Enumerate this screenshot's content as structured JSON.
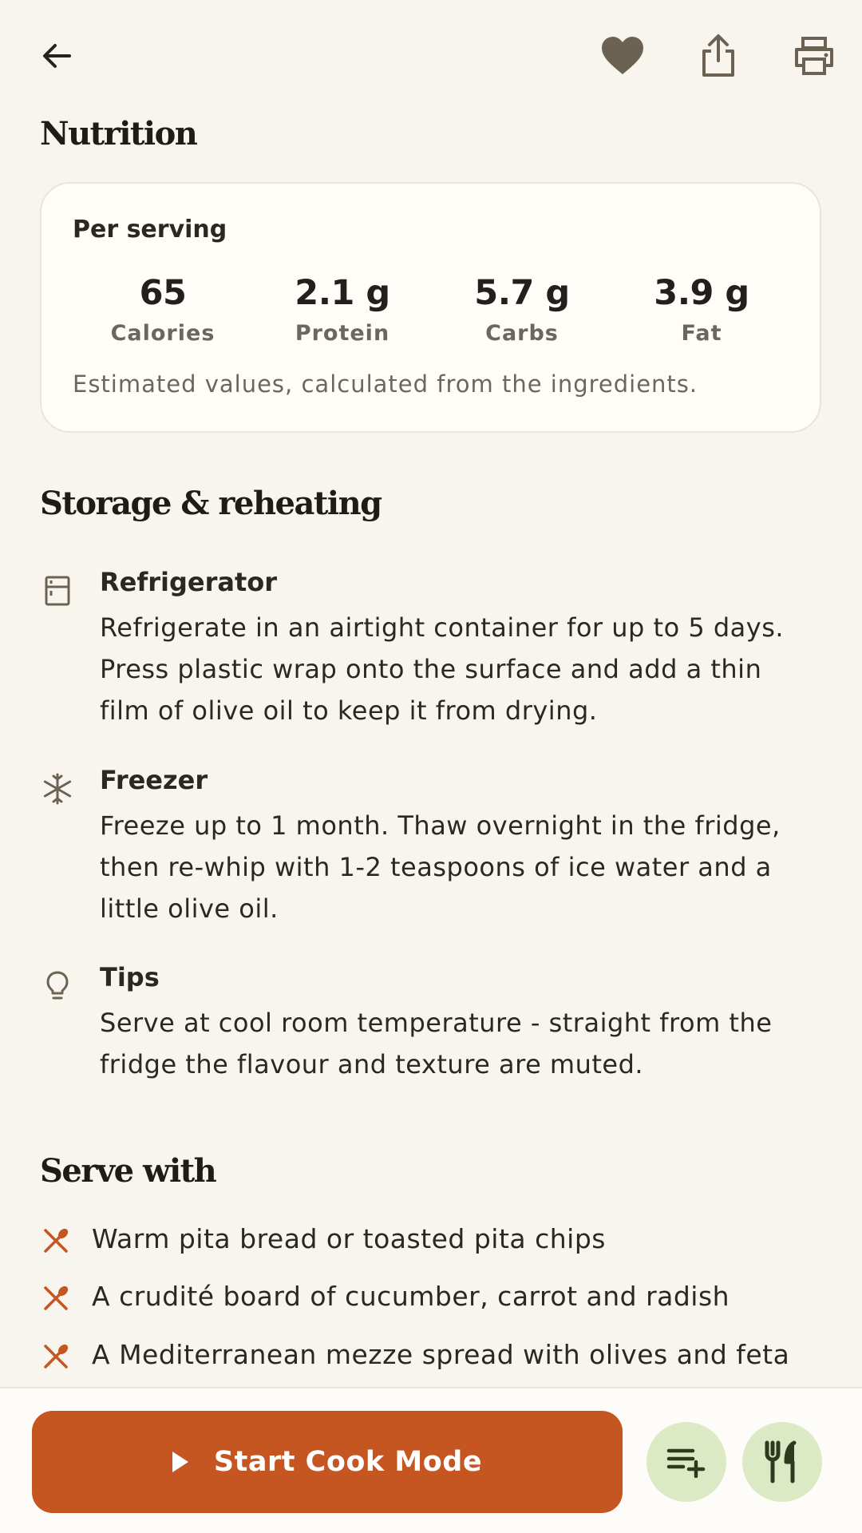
{
  "toolbar": {
    "back_icon": "arrow-left-icon",
    "favorite_icon": "heart-icon",
    "share_icon": "share-icon",
    "print_icon": "printer-icon"
  },
  "nutrition": {
    "title": "Nutrition",
    "per_serving": "Per serving",
    "items": [
      {
        "value": "65",
        "label": "Calories"
      },
      {
        "value": "2.1 g",
        "label": "Protein"
      },
      {
        "value": "5.7 g",
        "label": "Carbs"
      },
      {
        "value": "3.9 g",
        "label": "Fat"
      }
    ],
    "note": "Estimated values, calculated from the ingredients."
  },
  "storage": {
    "title": "Storage & reheating",
    "items": [
      {
        "icon": "refrigerator-icon",
        "title": "Refrigerator",
        "lines": [
          "Refrigerate in an airtight container for up to 5 days.",
          "Press plastic wrap onto the surface and add a thin",
          "film of olive oil to keep it from drying."
        ]
      },
      {
        "icon": "snowflake-icon",
        "title": "Freezer",
        "lines": [
          "Freeze up to 1 month. Thaw overnight in the fridge,",
          "then re-whip with 1-2 teaspoons of ice water and a",
          "little olive oil."
        ]
      },
      {
        "icon": "lightbulb-icon",
        "title": "Tips",
        "lines": [
          "Serve at cool room temperature - straight from the",
          "fridge the flavour and texture are muted."
        ]
      }
    ]
  },
  "serve_with": {
    "title": "Serve with",
    "items": [
      "Warm pita bread or toasted pita chips",
      "A crudité board of cucumber, carrot and radish",
      "A Mediterranean mezze spread with olives and feta"
    ]
  },
  "bottom": {
    "cook_mode_label": "Start Cook Mode",
    "add_list_icon": "playlist-add-icon",
    "utensils_icon": "utensils-icon"
  },
  "colors": {
    "accent": "#c55621",
    "accent_light": "#dbe9c4",
    "background": "#f8f5ee"
  }
}
